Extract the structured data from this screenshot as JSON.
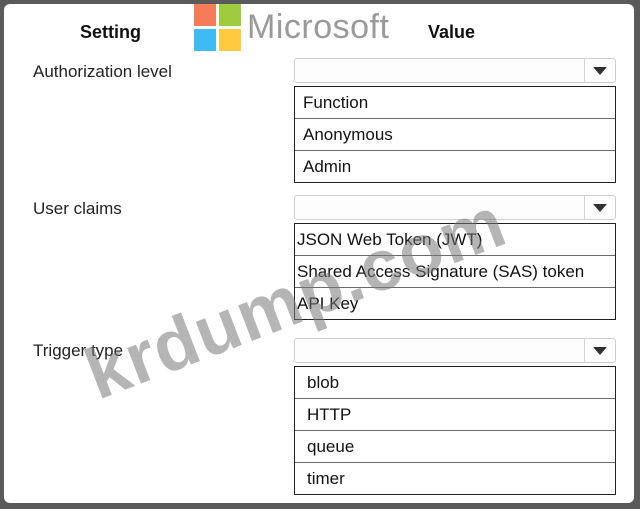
{
  "headers": {
    "setting": "Setting",
    "value": "Value"
  },
  "logo_text": "Microsoft",
  "watermark_text": "krdump.com",
  "rows": [
    {
      "label": "Authorization level",
      "options": [
        "Function",
        "Anonymous",
        "Admin"
      ]
    },
    {
      "label": "User claims",
      "options": [
        "JSON Web Token (JWT)",
        "Shared Access Signature (SAS) token",
        "API Key"
      ]
    },
    {
      "label": "Trigger type",
      "options": [
        "blob",
        "HTTP",
        "queue",
        "timer"
      ]
    }
  ],
  "icons": {
    "dropdown": "chevron-down-icon"
  },
  "colors": {
    "background": "#5a5a5a",
    "panel": "#ffffff",
    "watermark": "#787878"
  }
}
